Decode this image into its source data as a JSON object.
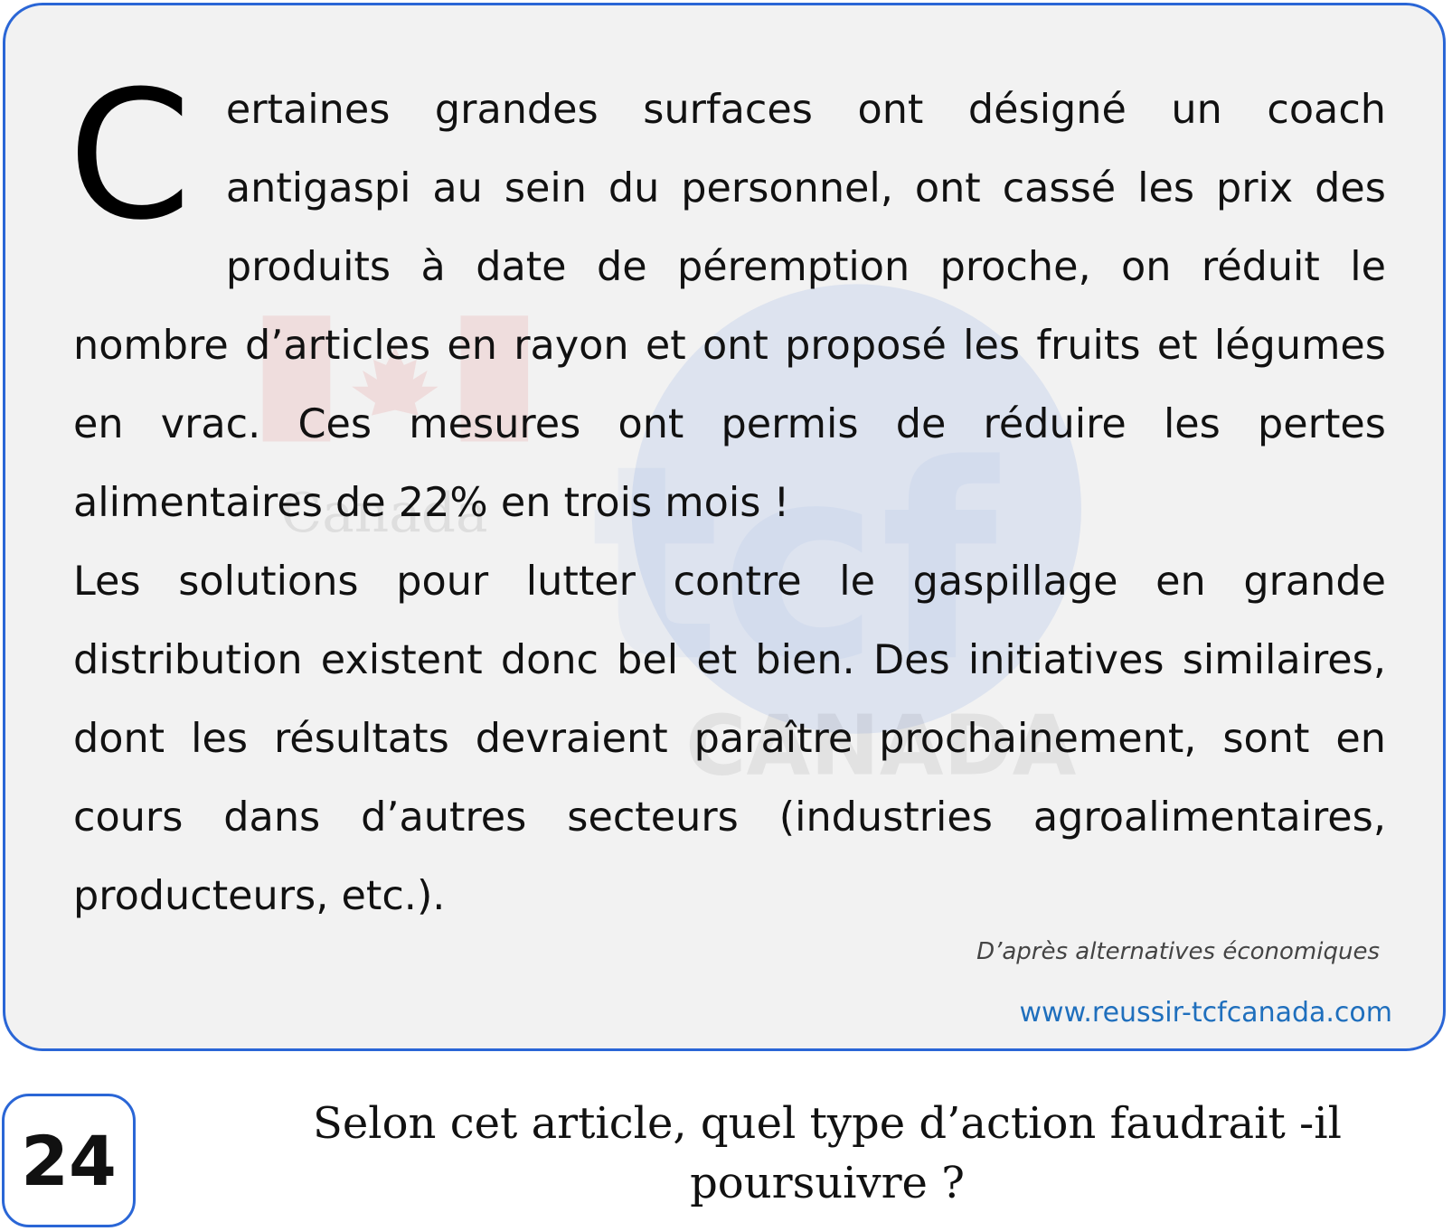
{
  "article": {
    "drop_cap": "C",
    "paragraph_1_rest": "ertaines grandes surfaces ont désigné un coach antigaspi au sein du personnel, ont cassé les prix des produits à date de péremption proche, on réduit le nombre d’articles en rayon et ont proposé les fruits et légumes en vrac. Ces mesures ont permis de réduire les pertes alimentaires de 22% en trois mois !",
    "paragraph_2": "Les solutions pour lutter contre le gaspillage en grande distribution existent donc bel et bien. Des initiatives similaires, dont les résultats devraient paraître prochainement, sont en cours dans d’autres secteurs (industries agroalimentaires, producteurs, etc.).",
    "source": "D’après alternatives économiques"
  },
  "site": {
    "url": "www.reussir-tcfcanada.com"
  },
  "watermark": {
    "canada_text": "Canada",
    "tcf_text": "tcf",
    "canada_caps": "CANADA"
  },
  "question": {
    "number": "24",
    "text": "Selon cet article, quel type d’action faudrait -il poursuivre ?"
  },
  "colors": {
    "accent_border": "#2a66d6",
    "link": "#1f6fbd",
    "card_background": "#f2f2f2"
  }
}
